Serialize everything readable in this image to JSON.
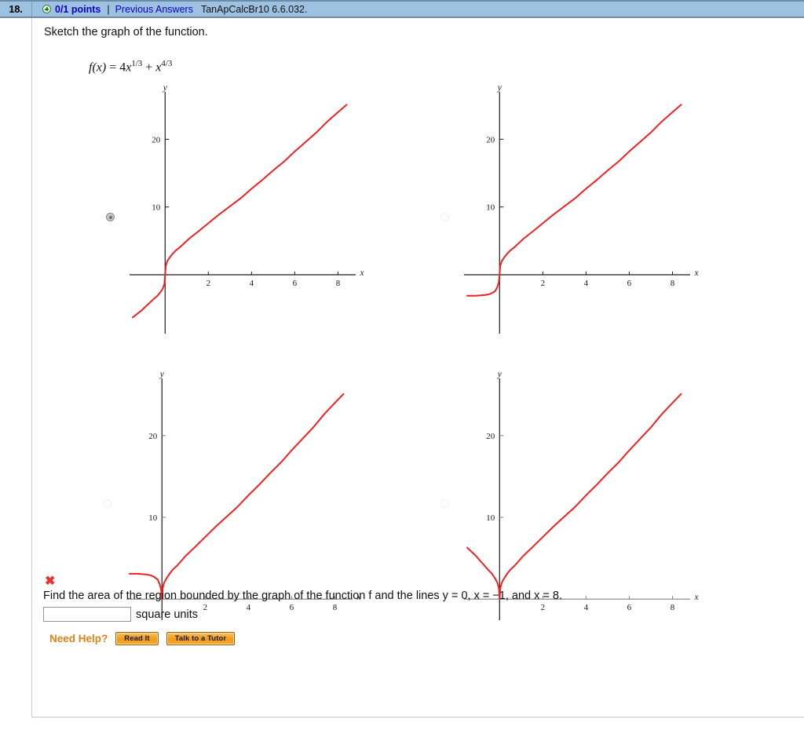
{
  "header": {
    "question_number": "18.",
    "plus_icon": "plus-circle-icon",
    "points": "0/1 points",
    "separator": "|",
    "previous_answers": "Previous Answers",
    "source_code": "TanApCalcBr10 6.6.032.",
    "bar_color": "#9dc1e0",
    "link_color": "#0a00c8"
  },
  "prompt": "Sketch the graph of the function.",
  "formula": {
    "lhs": "f(x)",
    "eq": "=",
    "term1_coef": "4",
    "term1_var": "x",
    "term1_exp": "1/3",
    "plus": "+",
    "term2_var": "x",
    "term2_exp": "4/3"
  },
  "choices": [
    {
      "id": "choice-a",
      "selected": true,
      "radio_state": "selected"
    },
    {
      "id": "choice-b",
      "selected": false,
      "radio_state": "unselected"
    },
    {
      "id": "choice-c",
      "selected": false,
      "radio_state": "unselected"
    },
    {
      "id": "choice-d",
      "selected": false,
      "radio_state": "unselected"
    }
  ],
  "question": {
    "incorrect_mark": "✖",
    "text": "Find the area of the region bounded by the graph of the function f and the lines  y = 0,  x = −1,  and  x = 8.",
    "answer_value": "",
    "answer_placeholder": "",
    "units": "square units"
  },
  "help": {
    "label": "Need Help?",
    "read_it": "Read It",
    "talk_to_tutor": "Talk to a Tutor",
    "accent_color": "#e08214"
  },
  "chart_data": [
    {
      "id": "choice-a",
      "type": "line",
      "title": "",
      "xlabel": "x",
      "ylabel": "y",
      "xlim": [
        -1.5,
        8.6
      ],
      "ylim": [
        -8,
        27
      ],
      "xticks": [
        2,
        4,
        6,
        8
      ],
      "yticks": [
        10,
        20
      ],
      "grid": false,
      "legend": "none",
      "curve_color": "#ee2222",
      "axis_color": "#1a1a1a",
      "description": "f(x) = 4*sign(x)*|x|^(1/3) + sign(x)*|x|^(4/3) — odd extension; passes through origin, dives below axis for x<0",
      "series": [
        {
          "name": "odd-extension",
          "x": [
            -1.5,
            -1.3,
            -1.1,
            -0.9,
            -0.7,
            -0.5,
            -0.35,
            -0.2,
            -0.1,
            -0.03,
            0,
            0.03,
            0.1,
            0.2,
            0.35,
            0.5,
            0.7,
            0.9,
            1.1,
            1.5,
            2,
            2.5,
            3,
            3.5,
            4,
            4.5,
            5,
            5.5,
            6,
            6.5,
            7,
            7.5,
            8,
            8.4
          ],
          "y": [
            -6.3,
            -5.8,
            -5.3,
            -4.7,
            -4.1,
            -3.5,
            -3.1,
            -2.5,
            -2.0,
            -1.3,
            0,
            1.3,
            2.0,
            2.5,
            3.1,
            3.6,
            4.1,
            4.7,
            5.3,
            6.3,
            7.6,
            8.9,
            10.1,
            11.3,
            12.7,
            14.0,
            15.4,
            16.7,
            18.2,
            19.6,
            21.0,
            22.6,
            24.0,
            25.1
          ]
        }
      ]
    },
    {
      "id": "choice-b",
      "type": "line",
      "title": "",
      "xlabel": "x",
      "ylabel": "y",
      "xlim": [
        -1.5,
        8.6
      ],
      "ylim": [
        -8,
        27
      ],
      "xticks": [
        2,
        4,
        6,
        8
      ],
      "yticks": [
        10,
        20
      ],
      "grid": false,
      "legend": "none",
      "curve_color": "#ee2222",
      "axis_color": "#1a1a1a",
      "description": "Right branch same as choice A; left branch drops below axis then flattens horizontally near y = -3",
      "series": [
        {
          "name": "left-branch",
          "x": [
            -1.5,
            -1.3,
            -1.1,
            -0.9,
            -0.7,
            -0.5,
            -0.35,
            -0.2,
            -0.1,
            -0.03,
            0
          ],
          "y": [
            -3.1,
            -3.1,
            -3.1,
            -3.05,
            -3.0,
            -2.9,
            -2.7,
            -2.4,
            -1.8,
            -1.0,
            0
          ]
        },
        {
          "name": "right-branch",
          "x": [
            0,
            0.03,
            0.1,
            0.2,
            0.35,
            0.5,
            0.7,
            0.9,
            1.1,
            1.5,
            2,
            2.5,
            3,
            3.5,
            4,
            4.5,
            5,
            5.5,
            6,
            6.5,
            7,
            7.5,
            8,
            8.4
          ],
          "y": [
            0,
            1.3,
            2.0,
            2.5,
            3.1,
            3.6,
            4.1,
            4.7,
            5.3,
            6.3,
            7.6,
            8.9,
            10.1,
            11.3,
            12.7,
            14.0,
            15.4,
            16.7,
            18.2,
            19.6,
            21.0,
            22.6,
            24.0,
            25.1
          ]
        }
      ]
    },
    {
      "id": "choice-c",
      "type": "line",
      "title": "",
      "xlabel": "x",
      "ylabel": "y",
      "xlim": [
        -1.5,
        8.6
      ],
      "ylim": [
        -2,
        27
      ],
      "xticks": [
        2,
        4,
        6,
        8
      ],
      "yticks": [
        10,
        20
      ],
      "grid": false,
      "legend": "none",
      "curve_color": "#ee2222",
      "axis_color": "#808080",
      "description": "Both branches above the x-axis meeting at origin; left branch rises only to about y = 3 and flattens",
      "series": [
        {
          "name": "left-branch",
          "x": [
            -1.5,
            -1.3,
            -1.1,
            -0.9,
            -0.7,
            -0.5,
            -0.35,
            -0.2,
            -0.1,
            -0.03,
            0
          ],
          "y": [
            3.1,
            3.1,
            3.1,
            3.05,
            3.0,
            2.9,
            2.7,
            2.4,
            1.8,
            1.0,
            0
          ]
        },
        {
          "name": "right-branch",
          "x": [
            0,
            0.03,
            0.1,
            0.2,
            0.35,
            0.5,
            0.7,
            0.9,
            1.1,
            1.5,
            2,
            2.5,
            3,
            3.5,
            4,
            4.5,
            5,
            5.5,
            6,
            6.5,
            7,
            7.5,
            8,
            8.4
          ],
          "y": [
            0,
            1.3,
            2.0,
            2.5,
            3.1,
            3.6,
            4.1,
            4.7,
            5.3,
            6.3,
            7.6,
            8.9,
            10.1,
            11.3,
            12.7,
            14.0,
            15.4,
            16.7,
            18.2,
            19.6,
            21.0,
            22.6,
            24.0,
            25.1
          ]
        }
      ]
    },
    {
      "id": "choice-d",
      "type": "line",
      "title": "",
      "xlabel": "x",
      "ylabel": "y",
      "xlim": [
        -1.5,
        8.6
      ],
      "ylim": [
        -2,
        27
      ],
      "xticks": [
        2,
        4,
        6,
        8
      ],
      "yticks": [
        10,
        20
      ],
      "grid": false,
      "legend": "none",
      "curve_color": "#ee2222",
      "axis_color": "#808080",
      "description": "Both branches above x-axis meeting at origin; left branch climbs steadily to about y = 6.3 — even extension |f|",
      "series": [
        {
          "name": "left-branch",
          "x": [
            -1.5,
            -1.3,
            -1.1,
            -0.9,
            -0.7,
            -0.5,
            -0.35,
            -0.2,
            -0.1,
            -0.03,
            0
          ],
          "y": [
            6.3,
            5.8,
            5.3,
            4.7,
            4.1,
            3.5,
            3.1,
            2.5,
            2.0,
            1.3,
            0
          ]
        },
        {
          "name": "right-branch",
          "x": [
            0,
            0.03,
            0.1,
            0.2,
            0.35,
            0.5,
            0.7,
            0.9,
            1.1,
            1.5,
            2,
            2.5,
            3,
            3.5,
            4,
            4.5,
            5,
            5.5,
            6,
            6.5,
            7,
            7.5,
            8,
            8.4
          ],
          "y": [
            0,
            1.3,
            2.0,
            2.5,
            3.1,
            3.6,
            4.1,
            4.7,
            5.3,
            6.3,
            7.6,
            8.9,
            10.1,
            11.3,
            12.7,
            14.0,
            15.4,
            16.7,
            18.2,
            19.6,
            21.0,
            22.6,
            24.0,
            25.1
          ]
        }
      ]
    }
  ]
}
